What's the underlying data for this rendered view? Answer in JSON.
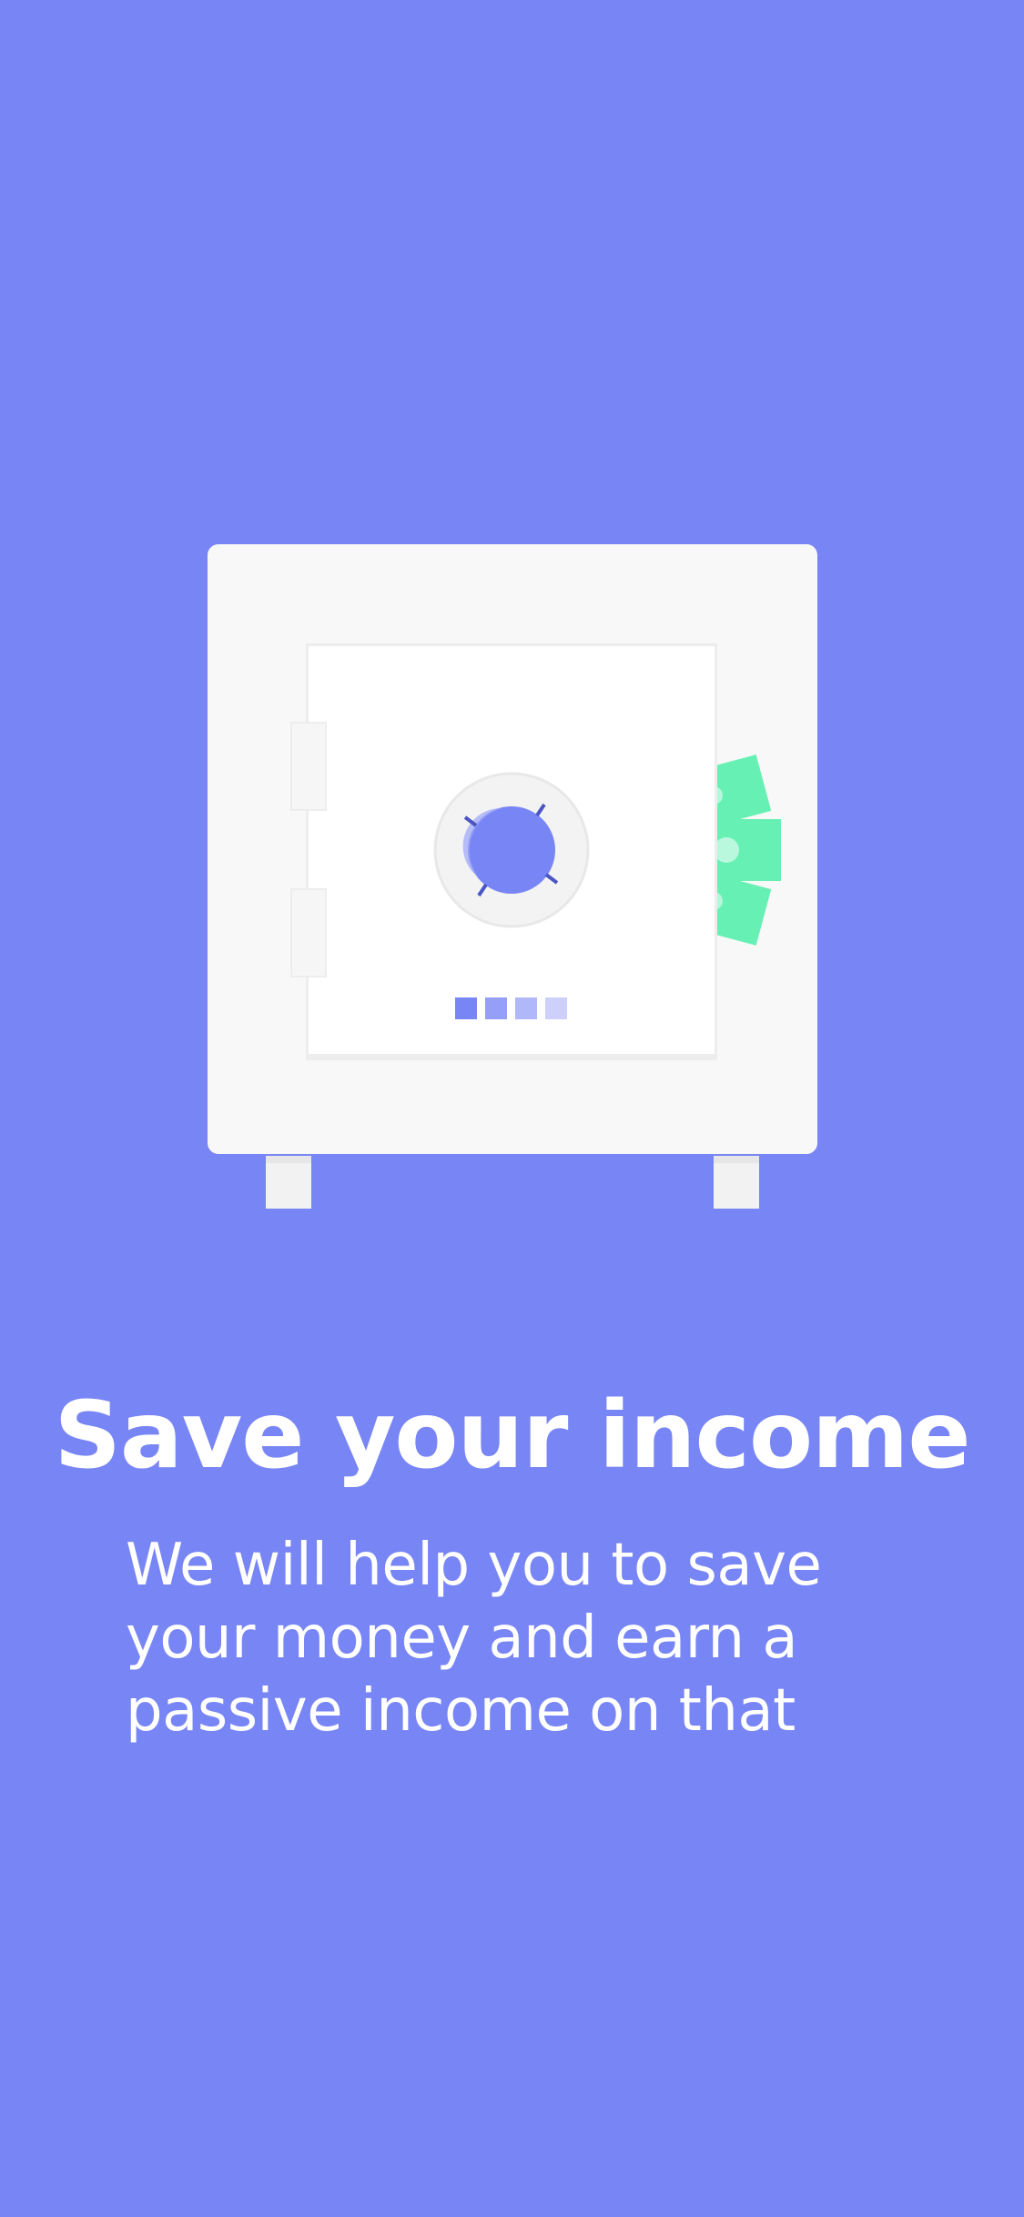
{
  "onboarding": {
    "title": "Save your income",
    "subtitle": "We will help you to save your money and earn a passive income on that"
  },
  "illustration": {
    "name": "safe-with-money",
    "colors": {
      "background": "#7885F5",
      "safe_body": "#F8F8F8",
      "safe_door": "#FFFFFF",
      "dial": "#7885F5",
      "money": "#67F0B4"
    }
  }
}
